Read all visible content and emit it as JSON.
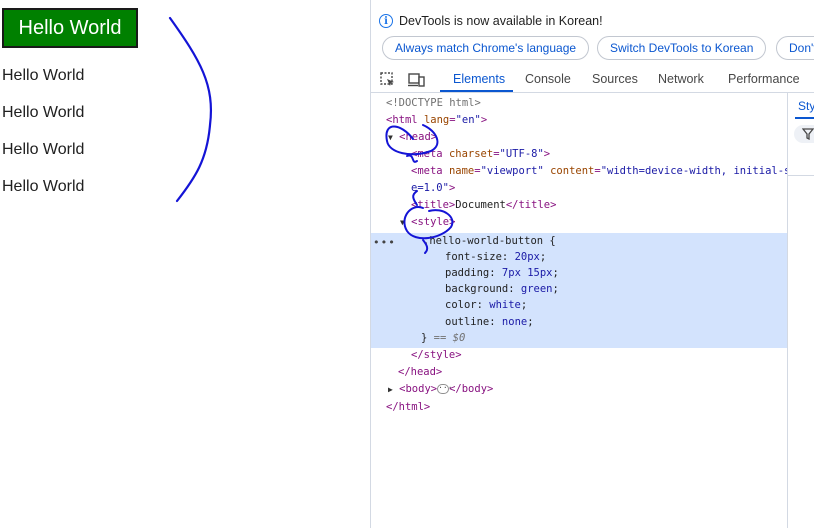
{
  "page": {
    "button_label": "Hello World",
    "paragraphs": [
      "Hello World",
      "Hello World",
      "Hello World",
      "Hello World"
    ]
  },
  "devtools": {
    "banner_text": "DevTools is now available in Korean!",
    "banner_buttons": [
      "Always match Chrome's language",
      "Switch DevTools to Korean",
      "Don't"
    ],
    "tabs": [
      "Elements",
      "Console",
      "Sources",
      "Network",
      "Performance"
    ],
    "active_tab": "Elements",
    "styles_tab_label": "Sty",
    "source": {
      "doctype": "<!DOCTYPE html>",
      "html_open": "<html",
      "lang_attr": "lang",
      "lang_val": "\"en\"",
      "head_open": "<head>",
      "meta1_open": "<meta",
      "charset_attr": "charset",
      "charset_val": "\"UTF-8\"",
      "meta2_open": "<meta",
      "name_attr": "name",
      "name_val": "\"viewport\"",
      "content_attr": "content",
      "content_val": "\"width=device-width, initial-scal",
      "content_val_wrap": "e=1.0\"",
      "title_open": "<title>",
      "title_text": "Document",
      "title_close": "</title>",
      "style_open": "<style>",
      "selector": ".hello-world-button {",
      "decls": [
        {
          "prop": "font-size",
          "val": "20px"
        },
        {
          "prop": "padding",
          "val": "7px 15px"
        },
        {
          "prop": "background",
          "val": "green"
        },
        {
          "prop": "color",
          "val": "white"
        },
        {
          "prop": "outline",
          "val": "none"
        }
      ],
      "close_brace": "}",
      "selected_ref": "== $0",
      "style_close": "</style>",
      "head_close": "</head>",
      "body_open": "<body>",
      "body_close": "</body>",
      "html_close": "</html>"
    }
  },
  "colors": {
    "button_bg": "#008000",
    "accent_blue": "#0b57d0",
    "selection_bg": "#d3e3fd",
    "ink_annotation": "#1414d6"
  }
}
